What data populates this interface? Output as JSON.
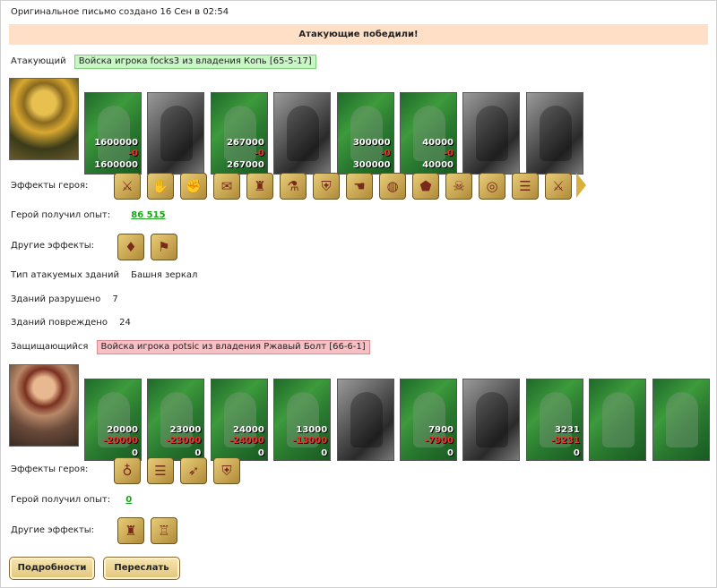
{
  "header": {
    "created_text": "Оригинальное письмо создано 16 Сен в 02:54"
  },
  "result_banner": "Атакующие победили!",
  "attacker": {
    "label": "Атакующий",
    "tag": "Войска игрока focks3 из владения Копь [65-5-17]",
    "units": [
      {
        "icon": "green-armored-soldier",
        "style": "green",
        "count": "1600000",
        "lost": "-0",
        "remaining": "1600000"
      },
      {
        "icon": "dark-knight",
        "style": "gray",
        "count": "",
        "lost": "",
        "remaining": ""
      },
      {
        "icon": "green-paladin",
        "style": "green",
        "count": "267000",
        "lost": "-0",
        "remaining": "267000"
      },
      {
        "icon": "gray-griffin",
        "style": "gray",
        "count": "",
        "lost": "",
        "remaining": ""
      },
      {
        "icon": "green-archer",
        "style": "green",
        "count": "300000",
        "lost": "-0",
        "remaining": "300000"
      },
      {
        "icon": "green-elf-warrior",
        "style": "green",
        "count": "40000",
        "lost": "-0",
        "remaining": "40000"
      },
      {
        "icon": "gray-hooded-guard",
        "style": "gray",
        "count": "",
        "lost": "",
        "remaining": ""
      },
      {
        "icon": "gray-mage",
        "style": "gray",
        "count": "",
        "lost": "",
        "remaining": ""
      }
    ],
    "hero_effects_label": "Эффекты героя:",
    "hero_effects": [
      "sword-icon",
      "handshake-icon",
      "gauntlet-icon",
      "scroll-icon",
      "fortress-icon",
      "potion-icon",
      "shield-icon",
      "hand-icon",
      "barrel-icon",
      "pentagon-icon",
      "demon-icon",
      "ring-icon",
      "parchment-icon",
      "blade-icon"
    ],
    "exp_label": "Герой получил опыт:",
    "exp_value": "86 515",
    "other_effects_label": "Другие эффекты:",
    "other_effects": [
      "bag-icon",
      "flag-icon"
    ]
  },
  "buildings": {
    "type_label": "Тип атакуемых зданий",
    "type_value": "Башня зеркал",
    "destroyed_label": "Зданий разрушено",
    "destroyed_value": "7",
    "damaged_label": "Зданий повреждено",
    "damaged_value": "24"
  },
  "defender": {
    "label": "Защищающийся",
    "tag": "Войска игрока potsic из владения Ржавый Болт [66-6-1]",
    "units": [
      {
        "icon": "green-armored-soldier",
        "style": "green",
        "count": "20000",
        "lost": "-20000",
        "remaining": "0"
      },
      {
        "icon": "green-swordsman",
        "style": "green",
        "count": "23000",
        "lost": "-23000",
        "remaining": "0"
      },
      {
        "icon": "green-paladin",
        "style": "green",
        "count": "24000",
        "lost": "-24000",
        "remaining": "0"
      },
      {
        "icon": "green-griffin",
        "style": "green",
        "count": "13000",
        "lost": "-13000",
        "remaining": "0"
      },
      {
        "icon": "gray-archer",
        "style": "gray",
        "count": "",
        "lost": "",
        "remaining": ""
      },
      {
        "icon": "green-elf-warrior",
        "style": "green",
        "count": "7900",
        "lost": "-7900",
        "remaining": "0"
      },
      {
        "icon": "gray-hooded-guard",
        "style": "gray",
        "count": "",
        "lost": "",
        "remaining": ""
      },
      {
        "icon": "green-druid",
        "style": "green",
        "count": "3231",
        "lost": "-3231",
        "remaining": "0"
      },
      {
        "icon": "green-tower-1",
        "style": "green",
        "count": "",
        "lost": "",
        "remaining": ""
      },
      {
        "icon": "green-tower-2",
        "style": "green",
        "count": "",
        "lost": "",
        "remaining": ""
      }
    ],
    "hero_effects_label": "Эффекты героя:",
    "hero_effects": [
      "amulet-icon",
      "parchment-icon",
      "bow-icon",
      "shield-icon"
    ],
    "exp_label": "Герой получил опыт:",
    "exp_value": "0",
    "other_effects_label": "Другие эффекты:",
    "other_effects": [
      "fortress-icon",
      "tower-icon"
    ]
  },
  "buttons": {
    "details": "Подробности",
    "forward": "Переслать"
  }
}
